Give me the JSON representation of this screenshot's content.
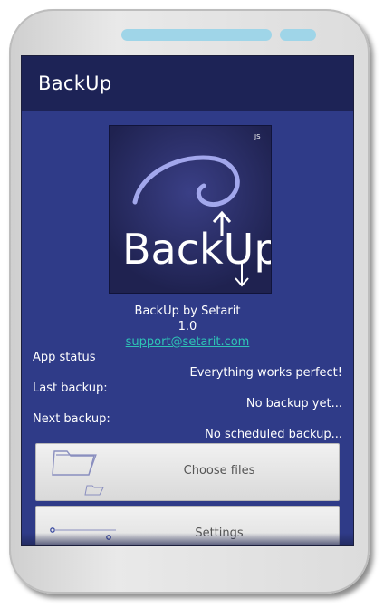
{
  "app": {
    "title": "BackUp"
  },
  "logo": {
    "text": "BackUp",
    "badge": "JS"
  },
  "about": {
    "name": "BackUp by Setarit",
    "version": "1.0",
    "email": "support@setarit.com"
  },
  "status": [
    {
      "label": "App status",
      "value": "Everything works perfect!"
    },
    {
      "label": "Last backup:",
      "value": "No backup yet..."
    },
    {
      "label": "Next backup:",
      "value": "No scheduled backup..."
    }
  ],
  "buttons": {
    "choose_files": "Choose files",
    "settings": "Settings"
  },
  "colors": {
    "app_bar": "#1d2356",
    "background": "#2f3b88",
    "link": "#2ec4b6",
    "button": "#e6e6e6"
  },
  "icons": [
    "folder-icon",
    "slider-settings-icon",
    "arrow-up-icon",
    "arrow-down-icon"
  ]
}
